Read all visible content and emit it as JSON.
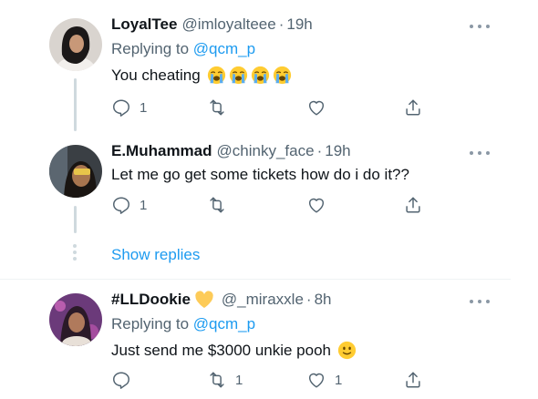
{
  "tweets": [
    {
      "name": "LoyalTee",
      "handle": "@imloyalteee",
      "dot": "·",
      "time": "19h",
      "replying_prefix": "Replying to ",
      "replying_to": "@qcm_p",
      "text": "You cheating",
      "emojis": [
        "loudly-crying-face",
        "loudly-crying-face",
        "loudly-crying-face",
        "loudly-crying-face"
      ],
      "actions": {
        "reply_count": "1",
        "retweet_count": "",
        "like_count": ""
      }
    },
    {
      "name": "E.Muhammad",
      "handle": "@chinky_face",
      "dot": "·",
      "time": "19h",
      "text": "Let me go get some tickets how do i do it??",
      "actions": {
        "reply_count": "1",
        "retweet_count": "",
        "like_count": ""
      }
    },
    {
      "name": "#LLDookie",
      "name_badge": "yellow-heart",
      "handle": "@_miraxxle",
      "dot": "·",
      "time": "8h",
      "replying_prefix": "Replying to ",
      "replying_to": "@qcm_p",
      "text": "Just send me $3000 unkie pooh",
      "emojis": [
        "slightly-smiling-face"
      ],
      "actions": {
        "reply_count": "",
        "retweet_count": "1",
        "like_count": "1"
      }
    }
  ],
  "show_replies": "Show replies",
  "colors": {
    "accent": "#1d9bf0",
    "secondary_text": "#536471",
    "primary_text": "#0f1419",
    "thread_line": "#cfd9de"
  }
}
